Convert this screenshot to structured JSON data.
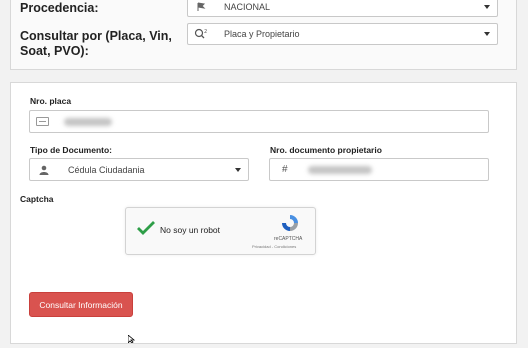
{
  "query": {
    "procedencia_label": "Procedencia:",
    "procedencia_value": "NACIONAL",
    "consultar_por_label_line1": "Consultar por (Placa, Vin,",
    "consultar_por_label_line2": "Soat, PVO):",
    "consultar_por_value": "Placa y Propietario"
  },
  "form": {
    "placa_label": "Nro. placa",
    "tipo_documento_label": "Tipo de Documento:",
    "tipo_documento_value": "Cédula Ciudadania",
    "nro_documento_label": "Nro. documento propietario",
    "nro_documento_prefix": "#",
    "captcha_label": "Captcha"
  },
  "captcha": {
    "checkbox_text": "No soy un robot",
    "brand": "reCAPTCHA",
    "links": "Privacidad - Condiciones"
  },
  "submit_label": "Consultar Información",
  "colors": {
    "accent_red": "#d9534f",
    "check_green": "#2e9e48",
    "recaptcha_blue": "#4a90e2"
  },
  "icons": [
    "flag-icon",
    "search-icon",
    "card-icon",
    "user-icon",
    "checkmark-icon",
    "recaptcha-icon",
    "cursor-icon"
  ]
}
